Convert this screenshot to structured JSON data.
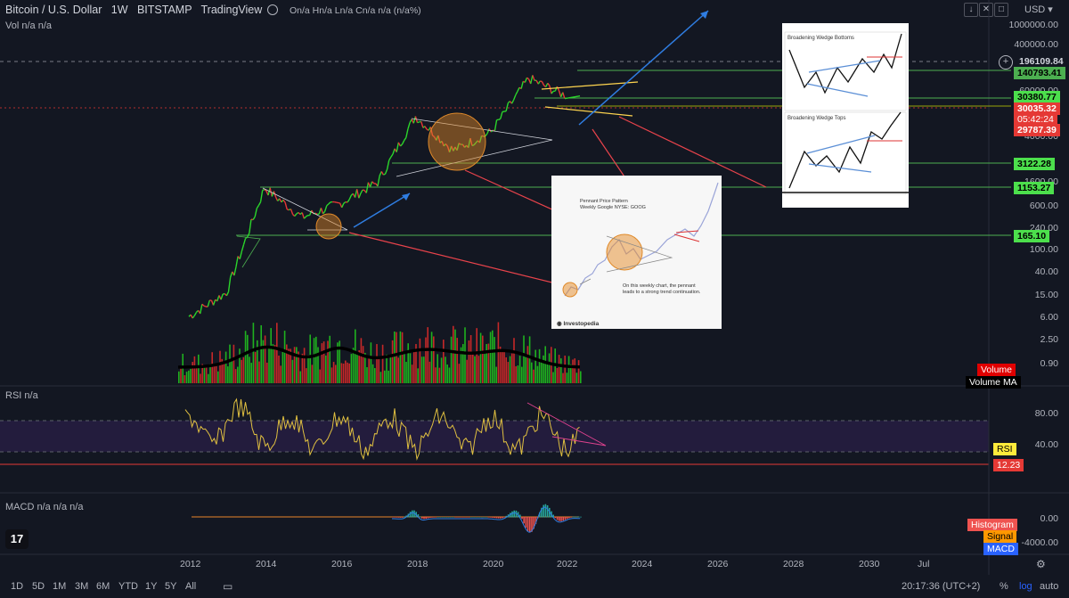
{
  "header": {
    "title": "Bitcoin / U.S. Dollar   1W   BITSTAMP   TradingView",
    "ohlc": "On/a  Hn/a  Ln/a  Cn/a  n/a (n/a%)",
    "currency": "USD"
  },
  "panes": {
    "volume_label": "Vol  n/a  n/a",
    "rsi_label": "RSI  n/a",
    "macd_label": "MACD  n/a  n/a  n/a"
  },
  "price_axis": [
    "1000000.00",
    "400000.00",
    "60000.00",
    "4000.00",
    "1600.00",
    "600.00",
    "240.00",
    "100.00",
    "40.00",
    "15.00",
    "6.00",
    "2.50",
    "0.90"
  ],
  "price_tags": {
    "crosshair": "196109.84",
    "level1": "140793.41",
    "level2": "30380.77",
    "current": "30035.32",
    "countdown": "05:42:24",
    "low": "29787.39",
    "level3": "3122.28",
    "level4": "1153.27",
    "level5": "165.10"
  },
  "legend": {
    "volume": "Volume",
    "volume_ma": "Volume MA",
    "rsi": "RSI",
    "rsi_value": "12.23",
    "histogram": "Histogram",
    "signal": "Signal",
    "macd": "MACD"
  },
  "rsi_axis": [
    "80.00",
    "40.00"
  ],
  "macd_axis": [
    "0.00",
    "-4000.00"
  ],
  "time_axis": [
    "2012",
    "2014",
    "2016",
    "2018",
    "2020",
    "2022",
    "2024",
    "2026",
    "2028",
    "2030",
    "Jul"
  ],
  "timeframes": [
    "1D",
    "5D",
    "1M",
    "3M",
    "6M",
    "YTD",
    "1Y",
    "5Y",
    "All"
  ],
  "footer": {
    "clock": "20:17:36 (UTC+2)",
    "percent": "%",
    "log": "log",
    "auto": "auto"
  },
  "insets": {
    "pennant_title": "Pennant Price Pattern",
    "pennant_subtitle": "Weekly Google NYSE: GOOG",
    "pennant_caption": "On this weekly chart, the pennant leads to a strong trend continuation.",
    "pennant_brand": "Investopedia",
    "wedge_title_1": "Broadening Wedge Bottoms",
    "wedge_title_2": "Broadening Wedge Tops"
  },
  "colors": {
    "background": "#131722",
    "up": "#26a69a",
    "candle_up": "#2bd62b",
    "candle_down": "#e53935",
    "green_level": "#4caf50",
    "rsi_line": "#e0c040",
    "rsi_band": "#2a1f4a",
    "annotation_red": "#e8434b",
    "annotation_blue": "#2f7de1",
    "annotation_yellow": "#ffd54f"
  },
  "chart_data": {
    "type": "line",
    "title": "Bitcoin / U.S. Dollar",
    "yscale": "log",
    "x": [
      2012,
      2013,
      2014,
      2015,
      2016,
      2017,
      2018,
      2019,
      2020,
      2021,
      2022
    ],
    "series": [
      {
        "values": [
          5,
          13,
          800,
          250,
          430,
          1000,
          13500,
          3500,
          7200,
          60000,
          30035
        ]
      }
    ],
    "ylim": [
      0.5,
      1000000
    ],
    "grid": false
  }
}
